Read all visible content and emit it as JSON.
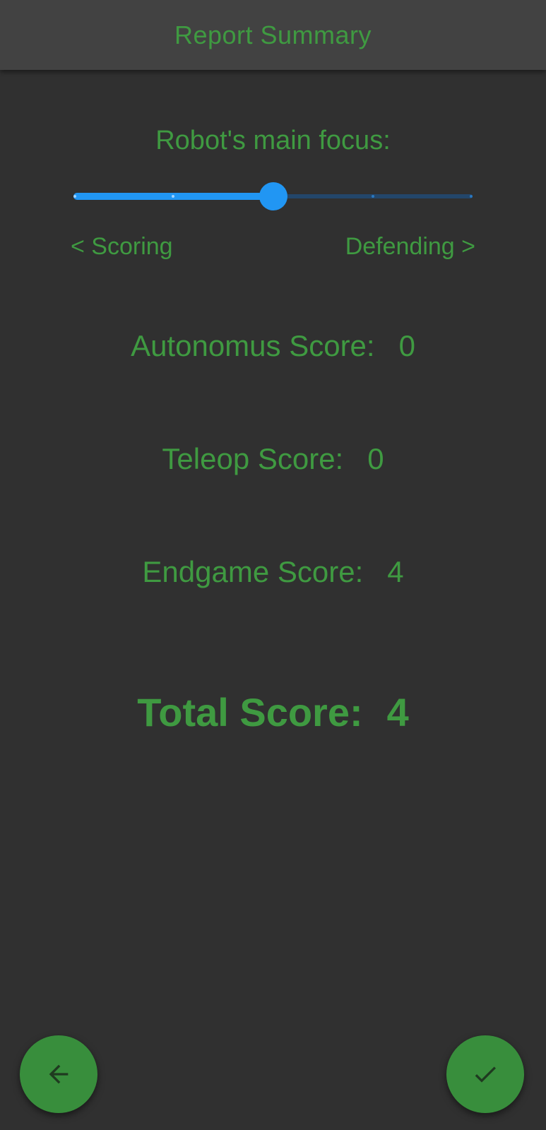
{
  "appbar": {
    "title": "Report Summary"
  },
  "focus": {
    "label": "Robot's main focus:",
    "left_label": "< Scoring",
    "right_label": "Defending >",
    "value": 0.5,
    "steps": 4
  },
  "scores": {
    "autonomus": {
      "label": "Autonomus Score:",
      "value": "0"
    },
    "teleop": {
      "label": "Teleop Score:",
      "value": "0"
    },
    "endgame": {
      "label": "Endgame Score:",
      "value": "4"
    },
    "total": {
      "label": "Total Score:",
      "value": "4"
    }
  },
  "actions": {
    "back_icon": "arrow-left-icon",
    "confirm_icon": "check-icon"
  },
  "colors": {
    "background": "#303030",
    "appbar": "#424242",
    "text_green": "#3f9a41",
    "slider_active": "#2196f3",
    "slider_inactive": "#23466a",
    "fab": "#388e3c"
  }
}
